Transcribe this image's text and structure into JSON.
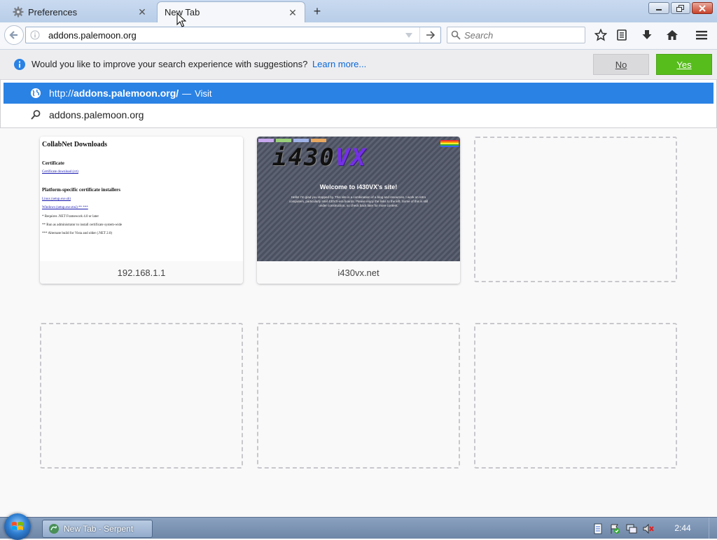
{
  "tabs": [
    {
      "title": "Preferences",
      "icon": "gear-icon",
      "active": false
    },
    {
      "title": "New Tab",
      "icon": "none",
      "active": true
    }
  ],
  "toolbar": {
    "url_value": "addons.palemoon.org",
    "search_placeholder": "Search"
  },
  "notification": {
    "text": "Would you like to improve your search experience with suggestions?",
    "learn_more": "Learn more...",
    "no_label": "No",
    "yes_label": "Yes"
  },
  "autocomplete": {
    "row1": {
      "url_prefix": "http://",
      "url_host": "addons.palemoon.org/",
      "separator": "—",
      "action": "Visit"
    },
    "row2": {
      "text": "addons.palemoon.org"
    }
  },
  "tiles": [
    {
      "caption": "192.168.1.1",
      "thumb": {
        "title": "CollabNet Downloads",
        "heading1": "Certificate",
        "link1": "Certificate download (crt)",
        "heading2": "Platform-specific certificate installers",
        "link2": "Linux (setup.exe.sh)",
        "link3": "Windows (setup.exe.msi) ** ***",
        "note1": "* Requires .NET Framework 4.0 or later",
        "note2": "** Run as administrator to install certificate system-wide",
        "note3": "*** Alternate build for Vista and older (.NET 2.0)"
      }
    },
    {
      "caption": "i430vx.net",
      "thumb": {
        "logo_main": "i430",
        "logo_accent": "VX",
        "welcome": "Welcome to i430VX's site!",
        "body": "Hello! I'm glad you stopped by. This site is a combination of a blog and resources. I work on retro computers, particularly Intel 430VX-era boards. Please enjoy the links to the left. Some of this is still under construction, so check back later for more content."
      }
    }
  ],
  "taskbar": {
    "task_label": "New Tab - Serpent",
    "clock": "2:44"
  },
  "colors": {
    "autocomplete_highlight": "#2a82e4",
    "yes_button": "#57bd1c",
    "link": "#0a67d8",
    "logo_accent": "#7430e6"
  }
}
